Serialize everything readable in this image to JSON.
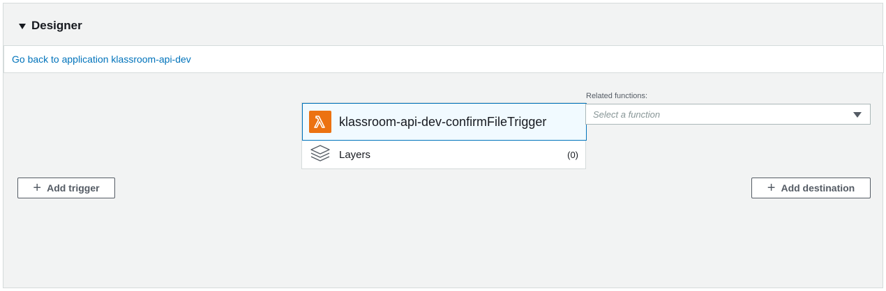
{
  "designer": {
    "title": "Designer"
  },
  "back_link": {
    "text": "Go back to application klassroom-api-dev"
  },
  "function": {
    "name": "klassroom-api-dev-confirmFileTrigger",
    "icon": "lambda-icon"
  },
  "layers": {
    "label": "Layers",
    "count": "(0)",
    "icon": "layers-icon"
  },
  "related_functions": {
    "label": "Related functions:",
    "placeholder": "Select a function"
  },
  "buttons": {
    "add_trigger": "Add trigger",
    "add_destination": "Add destination"
  },
  "colors": {
    "link": "#0073bb",
    "lambda_orange": "#ec7211",
    "selected_border": "#0073bb",
    "panel_bg": "#f2f3f3"
  }
}
